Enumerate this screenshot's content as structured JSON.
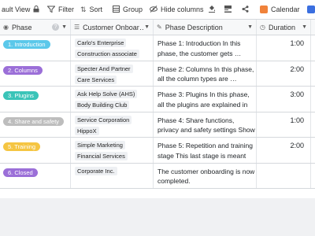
{
  "toolbar": {
    "view_label": "ault View",
    "filter_label": "Filter",
    "sort_label": "Sort",
    "group_label": "Group",
    "hide_label": "Hide columns",
    "calendar_label": "Calendar"
  },
  "columns": [
    {
      "label": "Phase"
    },
    {
      "label": "Customer Onboar…"
    },
    {
      "label": "Phase Description"
    },
    {
      "label": "Duration"
    }
  ],
  "rows": [
    {
      "phase": "1. Introduction",
      "phase_color": "#5bc8ea",
      "links": [
        "Carlo's Enterprise",
        "Construction associate"
      ],
      "desc": "Phase 1: Introduction In this phase, the customer gets …",
      "duration": "1:00"
    },
    {
      "phase": "2. Columns",
      "phase_color": "#9b6fd8",
      "links": [
        "Specter And Partner",
        "Care Services"
      ],
      "desc": "Phase 2: Columns In this phase, all the column types are …",
      "duration": "2:00"
    },
    {
      "phase": "3. Plugins",
      "phase_color": "#3ac4b8",
      "links": [
        "Ask Help Solve (AHS)",
        "Body Building Club"
      ],
      "desc": "Phase 3: Plugins In this phase, all the plugins are explained in …",
      "duration": "3:00"
    },
    {
      "phase": "4. Share and safety",
      "phase_color": "#bdbdbd",
      "links": [
        "Service Corporation",
        "HippoX"
      ],
      "desc": "Phase 4: Share functions, privacy and safety settings Show …",
      "duration": "1:00"
    },
    {
      "phase": "5. Training",
      "phase_color": "#f5c542",
      "links": [
        "Simple Marketing",
        "Financial Services"
      ],
      "desc": "Phase 5: Repetition and training stage This last stage is meant t…",
      "duration": "2:00"
    },
    {
      "phase": "6. Closed",
      "phase_color": "#9b6fd8",
      "links": [
        "Corporate Inc."
      ],
      "desc": "The customer onboarding is now completed.",
      "duration": ""
    }
  ]
}
